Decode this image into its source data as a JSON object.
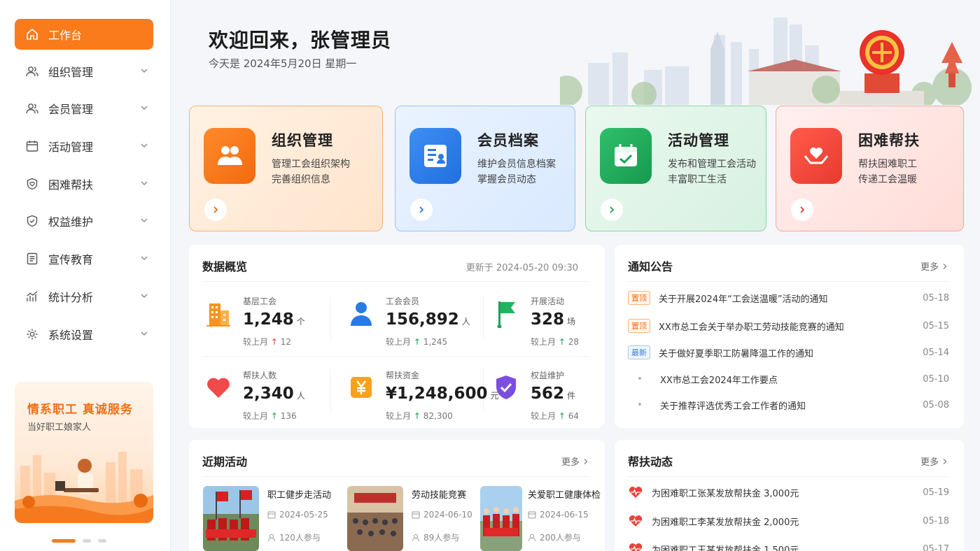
{
  "sidebar": {
    "items": [
      {
        "label": "工作台"
      },
      {
        "label": "组织管理"
      },
      {
        "label": "会员管理"
      },
      {
        "label": "活动管理"
      },
      {
        "label": "困难帮扶"
      },
      {
        "label": "权益维护"
      },
      {
        "label": "宣传教育"
      },
      {
        "label": "统计分析"
      },
      {
        "label": "系统设置"
      }
    ],
    "promo": {
      "title": "情系职工  真诚服务",
      "subtitle": "当好职工娘家人"
    },
    "carousel": {
      "active": 1,
      "count": 3
    }
  },
  "header": {
    "welcome": "欢迎回来，张管理员",
    "date": "今天是 2024年5月20日 星期一"
  },
  "quick_cards": [
    {
      "title": "组织管理",
      "desc1": "管理工会组织架构",
      "desc2": "完善组织信息",
      "color": "#f97b1c"
    },
    {
      "title": "会员档案",
      "desc1": "维护会员信息档案",
      "desc2": "掌握会员动态",
      "color": "#2f7fe6"
    },
    {
      "title": "活动管理",
      "desc1": "发布和管理工会活动",
      "desc2": "丰富职工生活",
      "color": "#1fa75a"
    },
    {
      "title": "困难帮扶",
      "desc1": "帮扶困难职工",
      "desc2": "传递工会温暖",
      "color": "#ee4a3f"
    }
  ],
  "overview": {
    "title": "数据概览",
    "updated": "更新于 2024-05-20 09:30",
    "stats": [
      {
        "label": "基层工会",
        "value": "1,248",
        "unit": "个",
        "trend_label": "较上月",
        "arrow": "↑",
        "delta": "12"
      },
      {
        "label": "工会会员",
        "value": "156,892",
        "unit": "人",
        "trend_label": "较上月",
        "arrow": "↑",
        "delta": "1,245"
      },
      {
        "label": "开展活动",
        "value": "328",
        "unit": "场",
        "trend_label": "较上月",
        "arrow": "↑",
        "delta": "28"
      },
      {
        "label": "帮扶人数",
        "value": "2,340",
        "unit": "人",
        "trend_label": "较上月",
        "arrow": "↑",
        "delta": "136"
      },
      {
        "label": "帮扶资金",
        "value": "¥1,248,600",
        "unit": "元",
        "trend_label": "较上月",
        "arrow": "↑",
        "delta": "82,300"
      },
      {
        "label": "权益维护",
        "value": "562",
        "unit": "件",
        "trend_label": "较上月",
        "arrow": "↑",
        "delta": "64"
      }
    ]
  },
  "notices": {
    "title": "通知公告",
    "more": "更多",
    "items": [
      {
        "tag": "置顶",
        "text": "关于开展2024年“工会送温暖”活动的通知",
        "date": "05-18"
      },
      {
        "tag": "置顶",
        "text": "XX市总工会关于举办职工劳动技能竞赛的通知",
        "date": "05-15"
      },
      {
        "tag": "最新",
        "text": "关于做好夏季职工防暑降温工作的通知",
        "date": "05-14"
      },
      {
        "tag": "",
        "text": "XX市总工会2024年工作要点",
        "date": "05-10"
      },
      {
        "tag": "",
        "text": "关于推荐评选优秀工会工作者的通知",
        "date": "05-08"
      }
    ]
  },
  "activities": {
    "title": "近期活动",
    "more": "更多",
    "items": [
      {
        "title": "职工健步走活动",
        "date": "2024-05-25",
        "join": "120人参与"
      },
      {
        "title": "劳动技能竞赛",
        "date": "2024-06-10",
        "join": "89人参与"
      },
      {
        "title": "关爱职工健康体检",
        "date": "2024-06-15",
        "join": "200人参与"
      }
    ]
  },
  "help_news": {
    "title": "帮扶动态",
    "more": "更多",
    "items": [
      {
        "text": "为困难职工张某发放帮扶金 3,000元",
        "date": "05-19"
      },
      {
        "text": "为困难职工李某发放帮扶金 2,000元",
        "date": "05-18"
      },
      {
        "text": "为困难职工王某发放帮扶金 1,500元",
        "date": "05-17"
      }
    ]
  }
}
